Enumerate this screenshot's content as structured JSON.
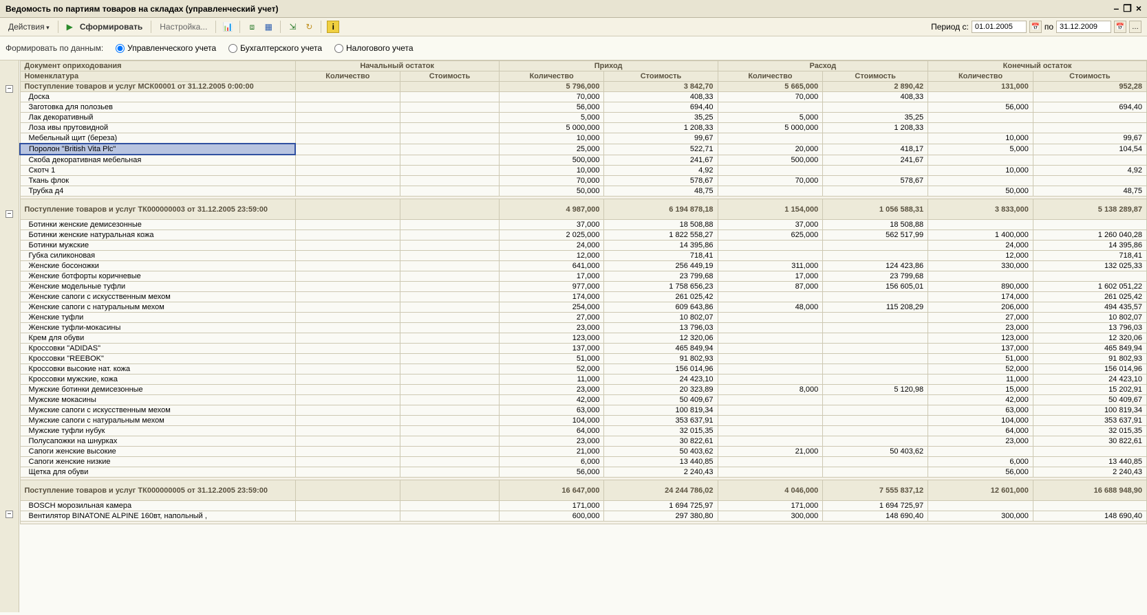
{
  "window": {
    "title": "Ведомость по партиям товаров на складах (управленческий учет)"
  },
  "toolbar": {
    "actions": "Действия",
    "form": "Сформировать",
    "settings": "Настройка...",
    "period_label": "Период с:",
    "period_from": "01.01.2005",
    "period_to_label": "по",
    "period_to": "31.12.2009"
  },
  "filter": {
    "label": "Формировать по данным:",
    "opt1": "Управленческого учета",
    "opt2": "Бухгалтерского учета",
    "opt3": "Налогового учета"
  },
  "headers": {
    "doc": "Документ оприходования",
    "nomen": "Номенклатура",
    "start": "Начальный остаток",
    "income": "Приход",
    "expense": "Расход",
    "end": "Конечный остаток",
    "qty": "Количество",
    "cost": "Стоимость"
  },
  "groups": [
    {
      "title": "Поступление товаров и услуг МСК00001 от 31.12.2005 0:00:00",
      "totals": {
        "in_q": "5 796,000",
        "in_c": "3 842,70",
        "ex_q": "5 665,000",
        "ex_c": "2 890,42",
        "en_q": "131,000",
        "en_c": "952,28"
      },
      "rows": [
        {
          "n": "Доска",
          "in_q": "70,000",
          "in_c": "408,33",
          "ex_q": "70,000",
          "ex_c": "408,33",
          "en_q": "",
          "en_c": ""
        },
        {
          "n": "Заготовка для полозьев",
          "in_q": "56,000",
          "in_c": "694,40",
          "ex_q": "",
          "ex_c": "",
          "en_q": "56,000",
          "en_c": "694,40"
        },
        {
          "n": "Лак декоративный",
          "in_q": "5,000",
          "in_c": "35,25",
          "ex_q": "5,000",
          "ex_c": "35,25",
          "en_q": "",
          "en_c": ""
        },
        {
          "n": "Лоза ивы прутовидной",
          "in_q": "5 000,000",
          "in_c": "1 208,33",
          "ex_q": "5 000,000",
          "ex_c": "1 208,33",
          "en_q": "",
          "en_c": ""
        },
        {
          "n": "Мебельный щит (береза)",
          "in_q": "10,000",
          "in_c": "99,67",
          "ex_q": "",
          "ex_c": "",
          "en_q": "10,000",
          "en_c": "99,67"
        },
        {
          "n": "Поролон \"British Vita Plc\"",
          "selected": true,
          "in_q": "25,000",
          "in_c": "522,71",
          "ex_q": "20,000",
          "ex_c": "418,17",
          "en_q": "5,000",
          "en_c": "104,54"
        },
        {
          "n": "Скоба декоративная мебельная",
          "in_q": "500,000",
          "in_c": "241,67",
          "ex_q": "500,000",
          "ex_c": "241,67",
          "en_q": "",
          "en_c": ""
        },
        {
          "n": "Скотч 1",
          "in_q": "10,000",
          "in_c": "4,92",
          "ex_q": "",
          "ex_c": "",
          "en_q": "10,000",
          "en_c": "4,92"
        },
        {
          "n": "Ткань флок",
          "in_q": "70,000",
          "in_c": "578,67",
          "ex_q": "70,000",
          "ex_c": "578,67",
          "en_q": "",
          "en_c": ""
        },
        {
          "n": "Трубка д4",
          "in_q": "50,000",
          "in_c": "48,75",
          "ex_q": "",
          "ex_c": "",
          "en_q": "50,000",
          "en_c": "48,75"
        }
      ]
    },
    {
      "title": "Поступление товаров и услуг ТК000000003 от 31.12.2005 23:59:00",
      "totals": {
        "in_q": "4 987,000",
        "in_c": "6 194 878,18",
        "ex_q": "1 154,000",
        "ex_c": "1 056 588,31",
        "en_q": "3 833,000",
        "en_c": "5 138 289,87"
      },
      "rows": [
        {
          "n": "Ботинки женские демисезонные",
          "in_q": "37,000",
          "in_c": "18 508,88",
          "ex_q": "37,000",
          "ex_c": "18 508,88",
          "en_q": "",
          "en_c": ""
        },
        {
          "n": "Ботинки женские натуральная кожа",
          "in_q": "2 025,000",
          "in_c": "1 822 558,27",
          "ex_q": "625,000",
          "ex_c": "562 517,99",
          "en_q": "1 400,000",
          "en_c": "1 260 040,28"
        },
        {
          "n": "Ботинки мужские",
          "in_q": "24,000",
          "in_c": "14 395,86",
          "ex_q": "",
          "ex_c": "",
          "en_q": "24,000",
          "en_c": "14 395,86"
        },
        {
          "n": "Губка силиконовая",
          "in_q": "12,000",
          "in_c": "718,41",
          "ex_q": "",
          "ex_c": "",
          "en_q": "12,000",
          "en_c": "718,41"
        },
        {
          "n": "Женские босоножки",
          "in_q": "641,000",
          "in_c": "256 449,19",
          "ex_q": "311,000",
          "ex_c": "124 423,86",
          "en_q": "330,000",
          "en_c": "132 025,33"
        },
        {
          "n": "Женские ботфорты коричневые",
          "in_q": "17,000",
          "in_c": "23 799,68",
          "ex_q": "17,000",
          "ex_c": "23 799,68",
          "en_q": "",
          "en_c": ""
        },
        {
          "n": "Женские модельные туфли",
          "in_q": "977,000",
          "in_c": "1 758 656,23",
          "ex_q": "87,000",
          "ex_c": "156 605,01",
          "en_q": "890,000",
          "en_c": "1 602 051,22"
        },
        {
          "n": "Женские сапоги с искусственным мехом",
          "in_q": "174,000",
          "in_c": "261 025,42",
          "ex_q": "",
          "ex_c": "",
          "en_q": "174,000",
          "en_c": "261 025,42"
        },
        {
          "n": "Женские сапоги с натуральным мехом",
          "in_q": "254,000",
          "in_c": "609 643,86",
          "ex_q": "48,000",
          "ex_c": "115 208,29",
          "en_q": "206,000",
          "en_c": "494 435,57"
        },
        {
          "n": "Женские туфли",
          "in_q": "27,000",
          "in_c": "10 802,07",
          "ex_q": "",
          "ex_c": "",
          "en_q": "27,000",
          "en_c": "10 802,07"
        },
        {
          "n": "Женские туфли-мокасины",
          "in_q": "23,000",
          "in_c": "13 796,03",
          "ex_q": "",
          "ex_c": "",
          "en_q": "23,000",
          "en_c": "13 796,03"
        },
        {
          "n": "Крем для обуви",
          "in_q": "123,000",
          "in_c": "12 320,06",
          "ex_q": "",
          "ex_c": "",
          "en_q": "123,000",
          "en_c": "12 320,06"
        },
        {
          "n": "Кроссовки \"ADIDAS\"",
          "in_q": "137,000",
          "in_c": "465 849,94",
          "ex_q": "",
          "ex_c": "",
          "en_q": "137,000",
          "en_c": "465 849,94"
        },
        {
          "n": "Кроссовки \"REEBOK\"",
          "in_q": "51,000",
          "in_c": "91 802,93",
          "ex_q": "",
          "ex_c": "",
          "en_q": "51,000",
          "en_c": "91 802,93"
        },
        {
          "n": "Кроссовки высокие нат. кожа",
          "in_q": "52,000",
          "in_c": "156 014,96",
          "ex_q": "",
          "ex_c": "",
          "en_q": "52,000",
          "en_c": "156 014,96"
        },
        {
          "n": "Кроссовки мужские, кожа",
          "in_q": "11,000",
          "in_c": "24 423,10",
          "ex_q": "",
          "ex_c": "",
          "en_q": "11,000",
          "en_c": "24 423,10"
        },
        {
          "n": "Мужские ботинки демисезонные",
          "in_q": "23,000",
          "in_c": "20 323,89",
          "ex_q": "8,000",
          "ex_c": "5 120,98",
          "en_q": "15,000",
          "en_c": "15 202,91"
        },
        {
          "n": "Мужские мокасины",
          "in_q": "42,000",
          "in_c": "50 409,67",
          "ex_q": "",
          "ex_c": "",
          "en_q": "42,000",
          "en_c": "50 409,67"
        },
        {
          "n": "Мужские сапоги с искусственным мехом",
          "in_q": "63,000",
          "in_c": "100 819,34",
          "ex_q": "",
          "ex_c": "",
          "en_q": "63,000",
          "en_c": "100 819,34"
        },
        {
          "n": "Мужские сапоги с натуральным мехом",
          "in_q": "104,000",
          "in_c": "353 637,91",
          "ex_q": "",
          "ex_c": "",
          "en_q": "104,000",
          "en_c": "353 637,91"
        },
        {
          "n": "Мужские туфли нубук",
          "in_q": "64,000",
          "in_c": "32 015,35",
          "ex_q": "",
          "ex_c": "",
          "en_q": "64,000",
          "en_c": "32 015,35"
        },
        {
          "n": "Полусапожки на шнурках",
          "in_q": "23,000",
          "in_c": "30 822,61",
          "ex_q": "",
          "ex_c": "",
          "en_q": "23,000",
          "en_c": "30 822,61"
        },
        {
          "n": "Сапоги женские высокие",
          "in_q": "21,000",
          "in_c": "50 403,62",
          "ex_q": "21,000",
          "ex_c": "50 403,62",
          "en_q": "",
          "en_c": ""
        },
        {
          "n": "Сапоги женские низкие",
          "in_q": "6,000",
          "in_c": "13 440,85",
          "ex_q": "",
          "ex_c": "",
          "en_q": "6,000",
          "en_c": "13 440,85"
        },
        {
          "n": "Щетка для обуви",
          "in_q": "56,000",
          "in_c": "2 240,43",
          "ex_q": "",
          "ex_c": "",
          "en_q": "56,000",
          "en_c": "2 240,43"
        }
      ]
    },
    {
      "title": "Поступление товаров и услуг ТК000000005 от 31.12.2005 23:59:00",
      "totals": {
        "in_q": "16 647,000",
        "in_c": "24 244 786,02",
        "ex_q": "4 046,000",
        "ex_c": "7 555 837,12",
        "en_q": "12 601,000",
        "en_c": "16 688 948,90"
      },
      "rows": [
        {
          "n": "BOSCH морозильная камера",
          "in_q": "171,000",
          "in_c": "1 694 725,97",
          "ex_q": "171,000",
          "ex_c": "1 694 725,97",
          "en_q": "",
          "en_c": ""
        },
        {
          "n": "Вентилятор BINATONE ALPINE 160вт, напольный ,",
          "in_q": "600,000",
          "in_c": "297 380,80",
          "ex_q": "300,000",
          "ex_c": "148 690,40",
          "en_q": "300,000",
          "en_c": "148 690,40"
        }
      ]
    }
  ]
}
